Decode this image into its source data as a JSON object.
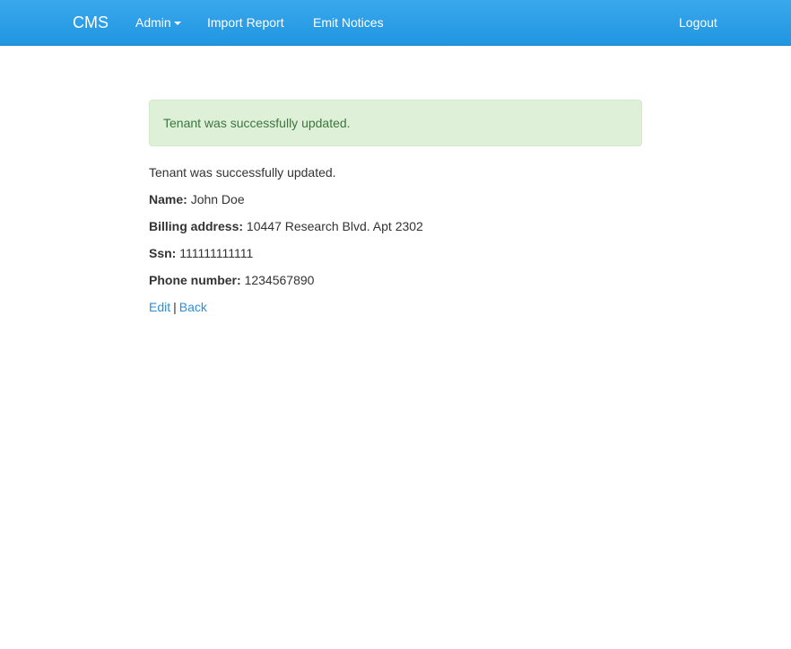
{
  "navbar": {
    "brand": "CMS",
    "items": [
      {
        "label": "Admin",
        "has_dropdown": true
      },
      {
        "label": "Import Report"
      },
      {
        "label": "Emit Notices"
      }
    ],
    "logout_label": "Logout",
    "color": "#2b9de6"
  },
  "alert": {
    "message": "Tenant was successfully updated.",
    "type": "success",
    "background": "#dff0d8",
    "text_color": "#3c763d"
  },
  "notice": "Tenant was successfully updated.",
  "tenant": {
    "name": {
      "label": "Name:",
      "value": "John Doe"
    },
    "billing_address": {
      "label": "Billing address:",
      "value": "10447 Research Blvd. Apt 2302"
    },
    "ssn": {
      "label": "Ssn:",
      "value": "111111111111"
    },
    "phone_number": {
      "label": "Phone number:",
      "value": "1234567890"
    }
  },
  "actions": {
    "edit_label": "Edit",
    "separator": "|",
    "back_label": "Back",
    "link_color": "#2a8fd9"
  }
}
